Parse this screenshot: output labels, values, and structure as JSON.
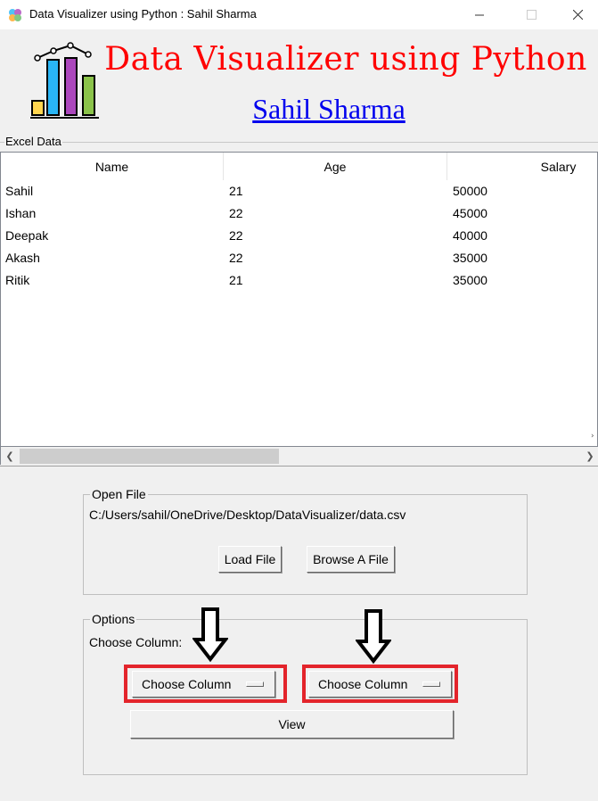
{
  "window": {
    "title": "Data Visualizer using Python : Sahil Sharma",
    "controls": [
      "minimize",
      "maximize",
      "close"
    ]
  },
  "header": {
    "heading": "Data Visualizer using Python",
    "author": "Sahil Sharma",
    "heading_color": "#ff0000",
    "author_color": "#0000ee",
    "logo_icon": "bar-chart-icon"
  },
  "excel_data": {
    "label": "Excel Data",
    "columns": [
      "Name",
      "Age",
      "Salary"
    ],
    "rows": [
      [
        "Sahil",
        "21",
        "50000"
      ],
      [
        "Ishan",
        "22",
        "45000"
      ],
      [
        "Deepak",
        "22",
        "40000"
      ],
      [
        "Akash",
        "22",
        "35000"
      ],
      [
        "Ritik",
        "21",
        "35000"
      ]
    ]
  },
  "open_file": {
    "label": "Open File",
    "path": "C:/Users/sahil/OneDrive/Desktop/DataVisualizer/data.csv",
    "load_label": "Load File",
    "browse_label": "Browse A File"
  },
  "options": {
    "label": "Options",
    "choose_label": "Choose Column:",
    "dropdown_1": "Choose Column",
    "dropdown_2": "Choose Column",
    "view_label": "View",
    "highlight_color": "#e3242b"
  }
}
